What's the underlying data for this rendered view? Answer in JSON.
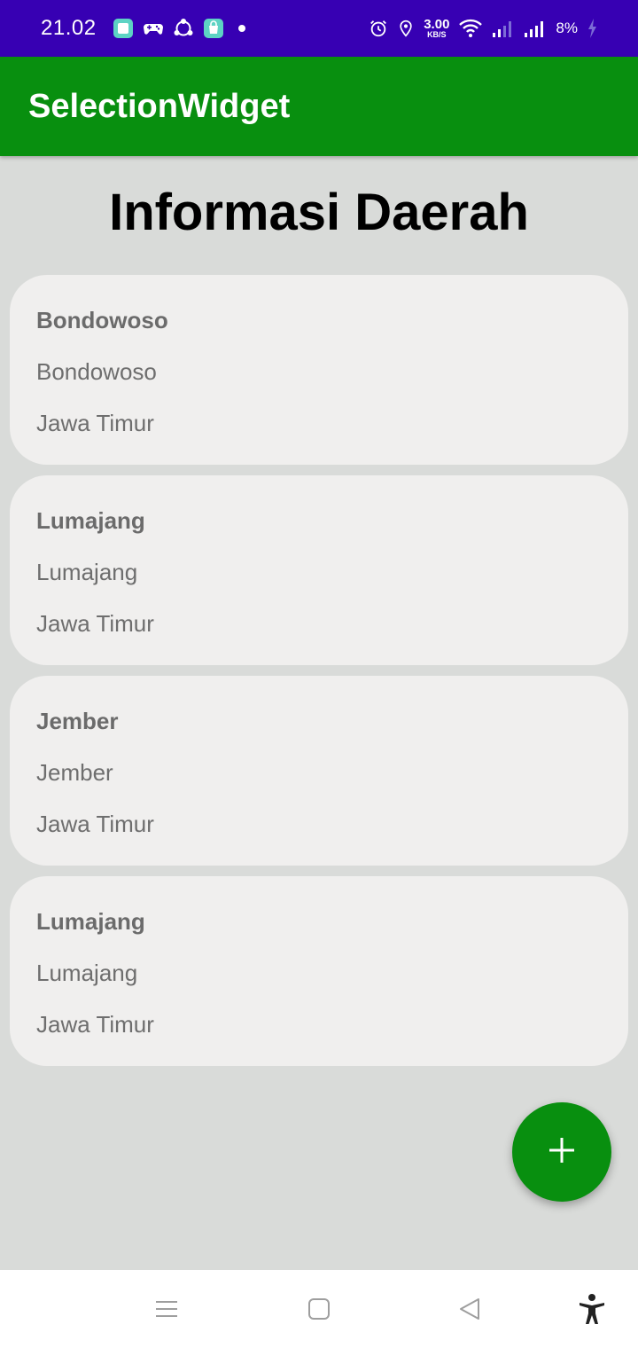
{
  "status_bar": {
    "time": "21.02",
    "network_speed_value": "3.00",
    "network_speed_unit": "KB/S",
    "battery_percent": "8%",
    "notification_icons": [
      "app-icon",
      "gamepad-icon",
      "share-icon",
      "store-icon"
    ],
    "status_icons": [
      "alarm-icon",
      "location-icon",
      "wifi-icon",
      "signal-icon",
      "signal-icon",
      "charging-icon"
    ]
  },
  "app_bar": {
    "title": "SelectionWidget"
  },
  "page": {
    "heading": "Informasi Daerah"
  },
  "cards": [
    {
      "title": "Bondowoso",
      "city": "Bondowoso",
      "province": "Jawa Timur"
    },
    {
      "title": "Lumajang",
      "city": "Lumajang",
      "province": "Jawa Timur"
    },
    {
      "title": "Jember",
      "city": "Jember",
      "province": "Jawa Timur"
    },
    {
      "title": "Lumajang",
      "city": "Lumajang",
      "province": "Jawa Timur"
    }
  ],
  "fab": {
    "icon": "plus-icon"
  },
  "nav_bar": {
    "items": [
      "menu-icon",
      "home-icon",
      "back-icon",
      "accessibility-icon"
    ]
  },
  "colors": {
    "status_bar": "#3700b3",
    "app_bar": "#088f0f",
    "background": "#d9dbd9",
    "card": "#f0efee",
    "fab": "#088f0f"
  }
}
